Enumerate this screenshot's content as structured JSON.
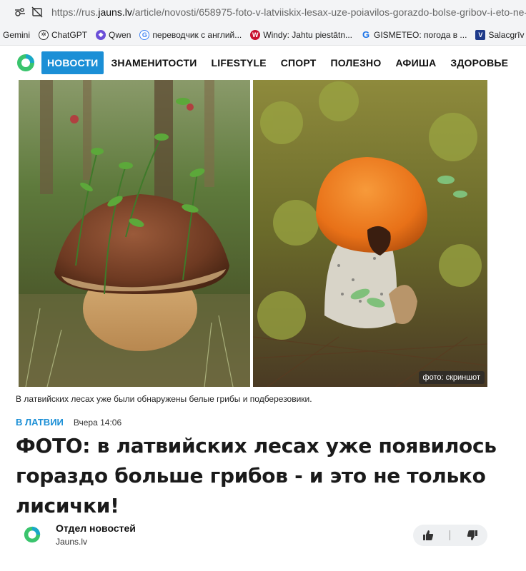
{
  "browser": {
    "url_prefix": "https://rus.",
    "url_domain": "jauns.lv",
    "url_path": "/article/novosti/658975-foto-v-latviiskix-lesax-uze-poiavilos-gorazdo-bolse-gribov-i-eto-ne-"
  },
  "bookmarks": [
    {
      "label": "Gemini",
      "icon": "gemini-icon"
    },
    {
      "label": "ChatGPT",
      "icon": "chatgpt-icon"
    },
    {
      "label": "Qwen",
      "icon": "qwen-icon"
    },
    {
      "label": "переводчик с англий...",
      "icon": "google-icon"
    },
    {
      "label": "Windy: Jahtu piestātn...",
      "icon": "windy-icon"
    },
    {
      "label": "GISMETEO: погода в ...",
      "icon": "gismeteo-icon"
    },
    {
      "label": "Salacgrīv",
      "icon": "v-icon"
    }
  ],
  "nav": {
    "items": [
      "НОВОСТИ",
      "ЗНАМЕНИТОСТИ",
      "LIFESTYLE",
      "СПОРТ",
      "ПОЛЕЗНО",
      "АФИША",
      "ЗДОРОВЬЕ"
    ],
    "active_index": 0
  },
  "article": {
    "photo_credit": "фото: скриншот",
    "caption": "В латвийских лесах уже были обнаружены белые грибы и подберезовики.",
    "category": "В ЛАТВИИ",
    "time": "Вчера 14:06",
    "headline": "ФОТО: в латвийских лесах уже появилось гораздо больше грибов - и это не только лисички!",
    "author_name": "Отдел новостей",
    "author_site": "Jauns.lv"
  },
  "colors": {
    "accent": "#1b8fd6",
    "logo_green": "#3ac46d",
    "logo_teal": "#1aa8c8"
  }
}
